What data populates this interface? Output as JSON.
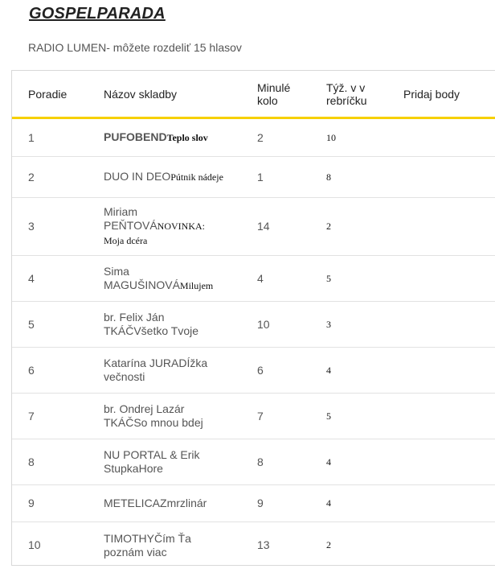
{
  "page": {
    "title": "GOSPELPARADA",
    "subtitle": "RADIO LUMEN- môžete rozdeliť 15 hlasov"
  },
  "table": {
    "headers": {
      "rank": "Poradie",
      "song": "Názov skladby",
      "last_round": "Minulé kolo",
      "weeks": "Týž. v v rebríčku",
      "add_points": "Pridaj body"
    },
    "rows": [
      {
        "rank": "1",
        "artist": "PUFOBEND",
        "title": "Teplo slov",
        "last_round": "2",
        "weeks": "10"
      },
      {
        "rank": "2",
        "artist": "DUO IN DEO",
        "title": "Pútnik nádeje",
        "last_round": "1",
        "weeks": "8"
      },
      {
        "rank": "3",
        "artist": "Miriam PEŇTOVÁ",
        "title": "NOVINKA: Moja dcéra",
        "last_round": "14",
        "weeks": "2"
      },
      {
        "rank": "4",
        "artist": "Sima MAGUŠINOVÁ",
        "title": "Milujem",
        "last_round": "4",
        "weeks": "5"
      },
      {
        "rank": "5",
        "artist": "br. Felix Ján TKÁČ",
        "title": "Všetko Tvoje",
        "last_round": "10",
        "weeks": "3"
      },
      {
        "rank": "6",
        "artist": "Katarína JURADÍ",
        "title": "žka večnosti",
        "last_round": "6",
        "weeks": "4"
      },
      {
        "rank": "7",
        "artist": "br. Ondrej Lazár TKÁČ",
        "title": "So mnou bdej",
        "last_round": "7",
        "weeks": "5"
      },
      {
        "rank": "8",
        "artist": "NU PORTAL & Erik Stupka",
        "title": "Hore",
        "last_round": "8",
        "weeks": "4"
      },
      {
        "rank": "9",
        "artist": "METELICA",
        "title": "Zmrzlinár",
        "last_round": "9",
        "weeks": "4"
      },
      {
        "rank": "10",
        "artist": "TIMOTHY",
        "title": "Čím Ťa poznám viac",
        "last_round": "13",
        "weeks": "2"
      }
    ]
  }
}
